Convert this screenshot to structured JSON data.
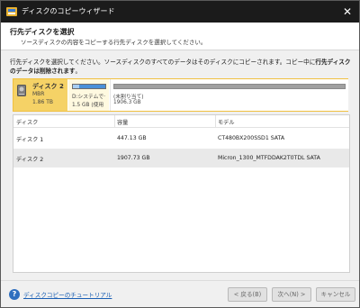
{
  "window": {
    "title": "ディスクのコピーウィザード",
    "close_label": "✕"
  },
  "header": {
    "title": "行先ディスクを選択",
    "subtitle": "ソースディスクの内容をコピーする行先ディスクを選択してください。"
  },
  "instruction": {
    "text": "行先ディスクを選択してください。ソースディスクのすべてのデータはそのディスクにコピーされます。コピー中に",
    "bold_1": "行先ディスクのデータは削除されます",
    "end": "。"
  },
  "disk_map": {
    "disk_name": "ディスク 2",
    "disk_type": "MBR",
    "disk_size": "1.86 TB",
    "partitions": [
      {
        "label": "D:システムで·",
        "size": "1.5 GB (使用",
        "used_fraction": 0.2,
        "color": "#4a90d9"
      },
      {
        "label": "(未割り当て)",
        "size": "1906.3 GB",
        "color": "#a0a0a0"
      }
    ]
  },
  "table": {
    "headers": [
      "ディスク",
      "容量",
      "モデル"
    ],
    "rows": [
      {
        "disk": "ディスク 1",
        "capacity": "447.13 GB",
        "model": "CT480BX200SSD1 SATA"
      },
      {
        "disk": "ディスク 2",
        "capacity": "1907.73 GB",
        "model": "Micron_1300_MTFDDAK2T0TDL SATA"
      }
    ],
    "selected_index": 1
  },
  "footer": {
    "help_link": "ディスクコピーのチュートリアル",
    "back": "< 戻る(B)",
    "next": "次へ(N) >",
    "cancel": "キャンセル"
  }
}
